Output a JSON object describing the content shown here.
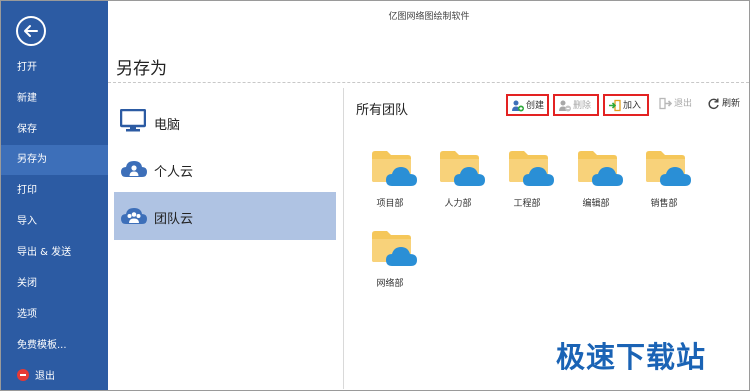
{
  "app": {
    "title": "亿图网络图绘制软件"
  },
  "sidebar": {
    "items": [
      {
        "label": "打开"
      },
      {
        "label": "新建"
      },
      {
        "label": "保存"
      },
      {
        "label": "另存为",
        "active": true
      },
      {
        "label": "打印"
      },
      {
        "label": "导入"
      },
      {
        "label": "导出 & 发送"
      },
      {
        "label": "关闭"
      },
      {
        "label": "选项"
      },
      {
        "label": "免费模板..."
      },
      {
        "label": "退出",
        "icon": "exit-icon"
      }
    ]
  },
  "page": {
    "title": "另存为"
  },
  "locations": [
    {
      "label": "电脑",
      "icon": "monitor-icon"
    },
    {
      "label": "个人云",
      "icon": "person-cloud-icon"
    },
    {
      "label": "团队云",
      "icon": "team-cloud-icon",
      "selected": true
    }
  ],
  "panel": {
    "title": "所有团队",
    "toolbar": {
      "create": "创建",
      "delete": "删除",
      "join": "加入",
      "quit": "退出",
      "refresh": "刷新"
    },
    "folders": [
      {
        "label": "项目部"
      },
      {
        "label": "人力部"
      },
      {
        "label": "工程部"
      },
      {
        "label": "编辑部"
      },
      {
        "label": "销售部"
      },
      {
        "label": "网络部"
      }
    ]
  },
  "watermark": {
    "text": "极速下载站"
  },
  "colors": {
    "sidebar": "#2c5ba3",
    "sidebar_active": "#3d6fb9",
    "selected_location": "#afc3e3",
    "folder": "#f5c75a",
    "cloud": "#2a8fd6",
    "highlight_border": "#e32222",
    "watermark": "#1a63b5"
  }
}
